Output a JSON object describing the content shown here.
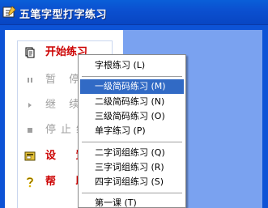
{
  "window": {
    "title": "五笔字型打字练习"
  },
  "left_menu": [
    {
      "label": "开始练习",
      "icon": "document-icon",
      "state": "active"
    },
    {
      "label": "暂 停",
      "icon": "pause-icon",
      "state": "disabled"
    },
    {
      "label": "继 续",
      "icon": "play-icon",
      "state": "disabled"
    },
    {
      "label": "停止练习",
      "icon": "stop-icon",
      "state": "disabled"
    },
    {
      "label": "设 置",
      "icon": "settings-icon",
      "state": "red"
    },
    {
      "label": "帮 助",
      "icon": "help-icon",
      "state": "red"
    }
  ],
  "popup_menu": {
    "items": [
      {
        "label": "字根练习 (L)"
      },
      {
        "label": "一级简码练习 (M)",
        "highlighted": true
      },
      {
        "label": "二级简码练习 (N)"
      },
      {
        "label": "三级简码练习 (O)"
      },
      {
        "label": "单字练习 (P)"
      },
      {
        "label": "二字词组练习 (Q)"
      },
      {
        "label": "三字词组练习 (R)"
      },
      {
        "label": "四字词组练习 (S)"
      },
      {
        "label": "第一课 (T)"
      }
    ]
  },
  "colors": {
    "title_bar": "#0b4fcf",
    "highlight": "#316ac5",
    "active_text": "#cc0000",
    "disabled_text": "#a0a0a0"
  }
}
